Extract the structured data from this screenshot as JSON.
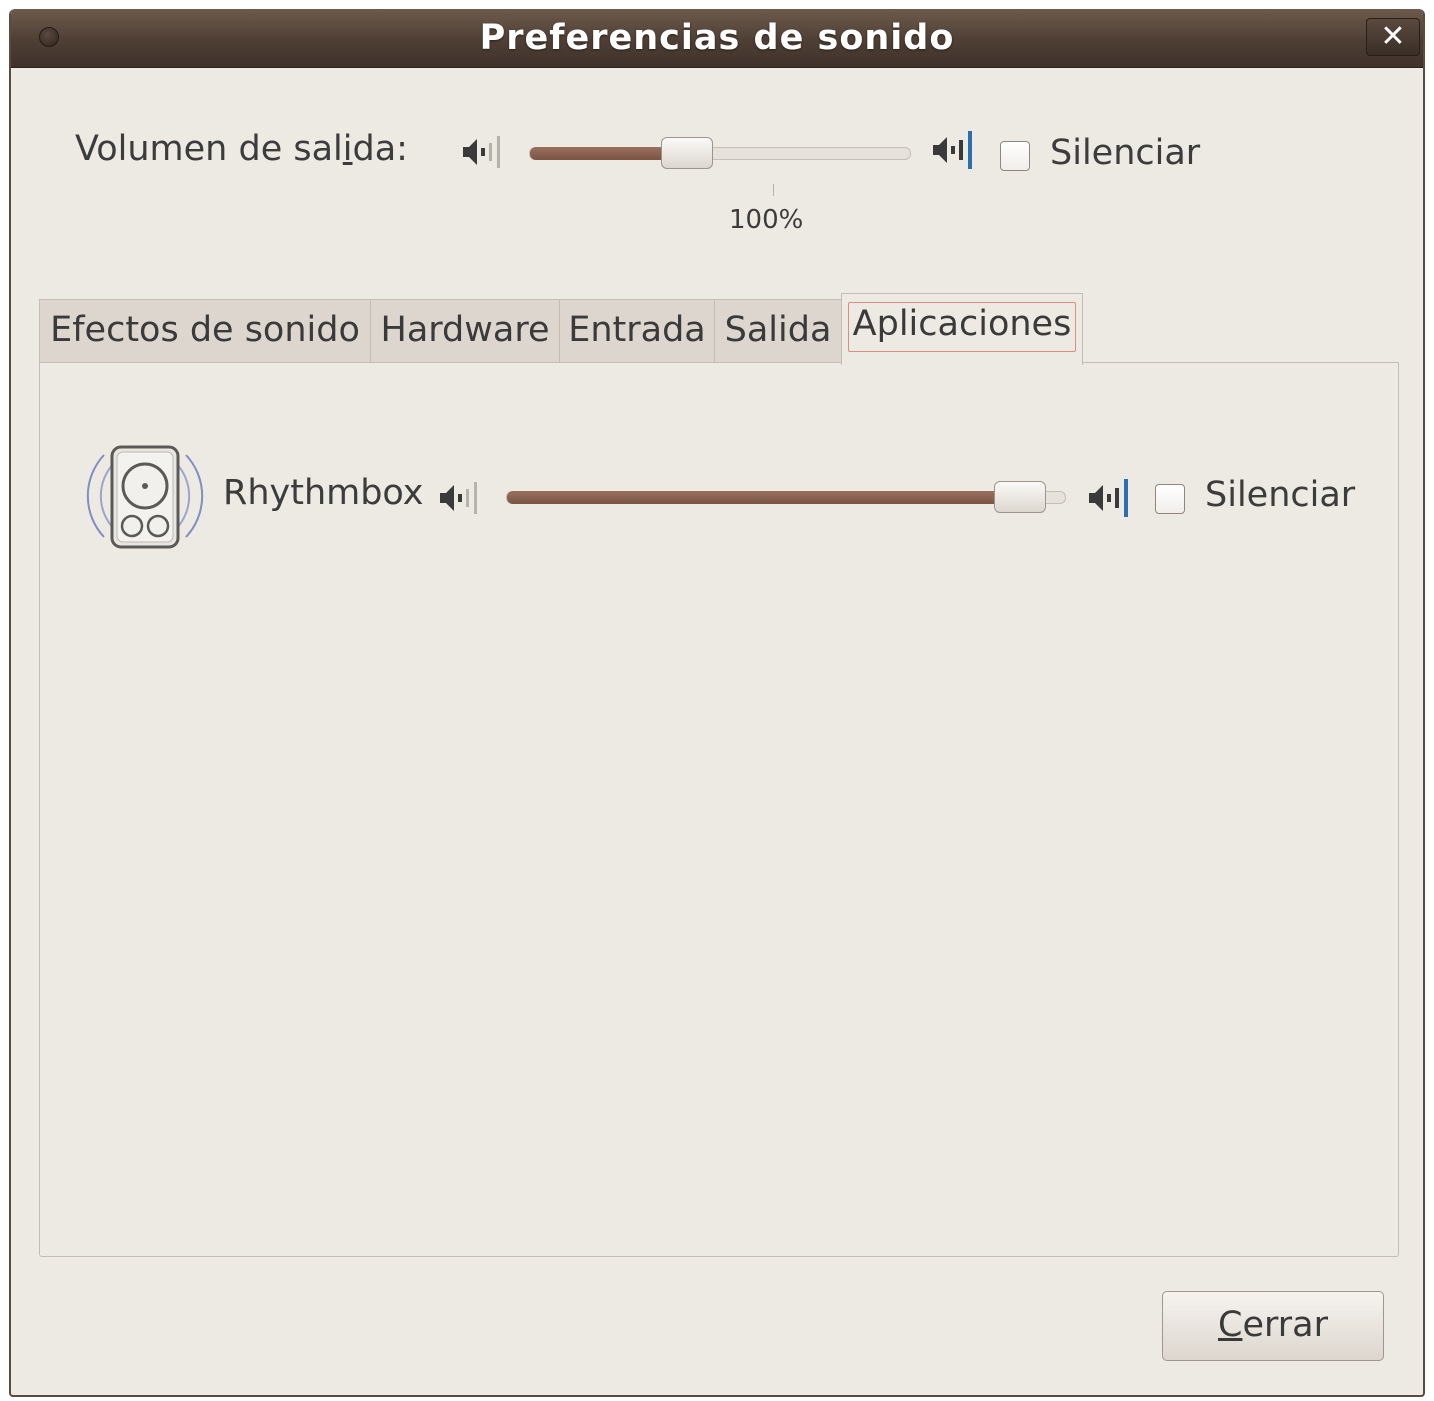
{
  "window": {
    "title": "Preferencias de sonido",
    "close_glyph": "✕"
  },
  "output": {
    "label_before": "Volumen de sal",
    "label_mnemonic": "i",
    "label_mid": "d",
    "label_after": "a:",
    "volume_percent": 100,
    "volume_fraction": 0.4,
    "scale_mark_label": "100%",
    "mute_label": "Silenciar",
    "mute_checked": false
  },
  "tabs": [
    {
      "label": "Efectos de sonido",
      "active": false
    },
    {
      "label": "Hardware",
      "active": false
    },
    {
      "label": "Entrada",
      "active": false
    },
    {
      "label": "Salida",
      "active": false
    },
    {
      "label": "Aplicaciones",
      "active": true
    }
  ],
  "applications": [
    {
      "name": "Rhythmbox",
      "icon": "speaker-icon",
      "volume_fraction": 0.96,
      "mute_label": "Silenciar",
      "mute_checked": false
    }
  ],
  "footer": {
    "close_mnemonic": "C",
    "close_rest": "errar"
  },
  "icons": {
    "volume_low": "volume-low-icon",
    "volume_high": "volume-high-icon",
    "window_menu": "window-menu-icon"
  },
  "colors": {
    "titlebar": "#4e3f35",
    "slider_fill": "#7b5444",
    "background": "#ede9e3",
    "accent_blue": "#2c6fb0"
  }
}
